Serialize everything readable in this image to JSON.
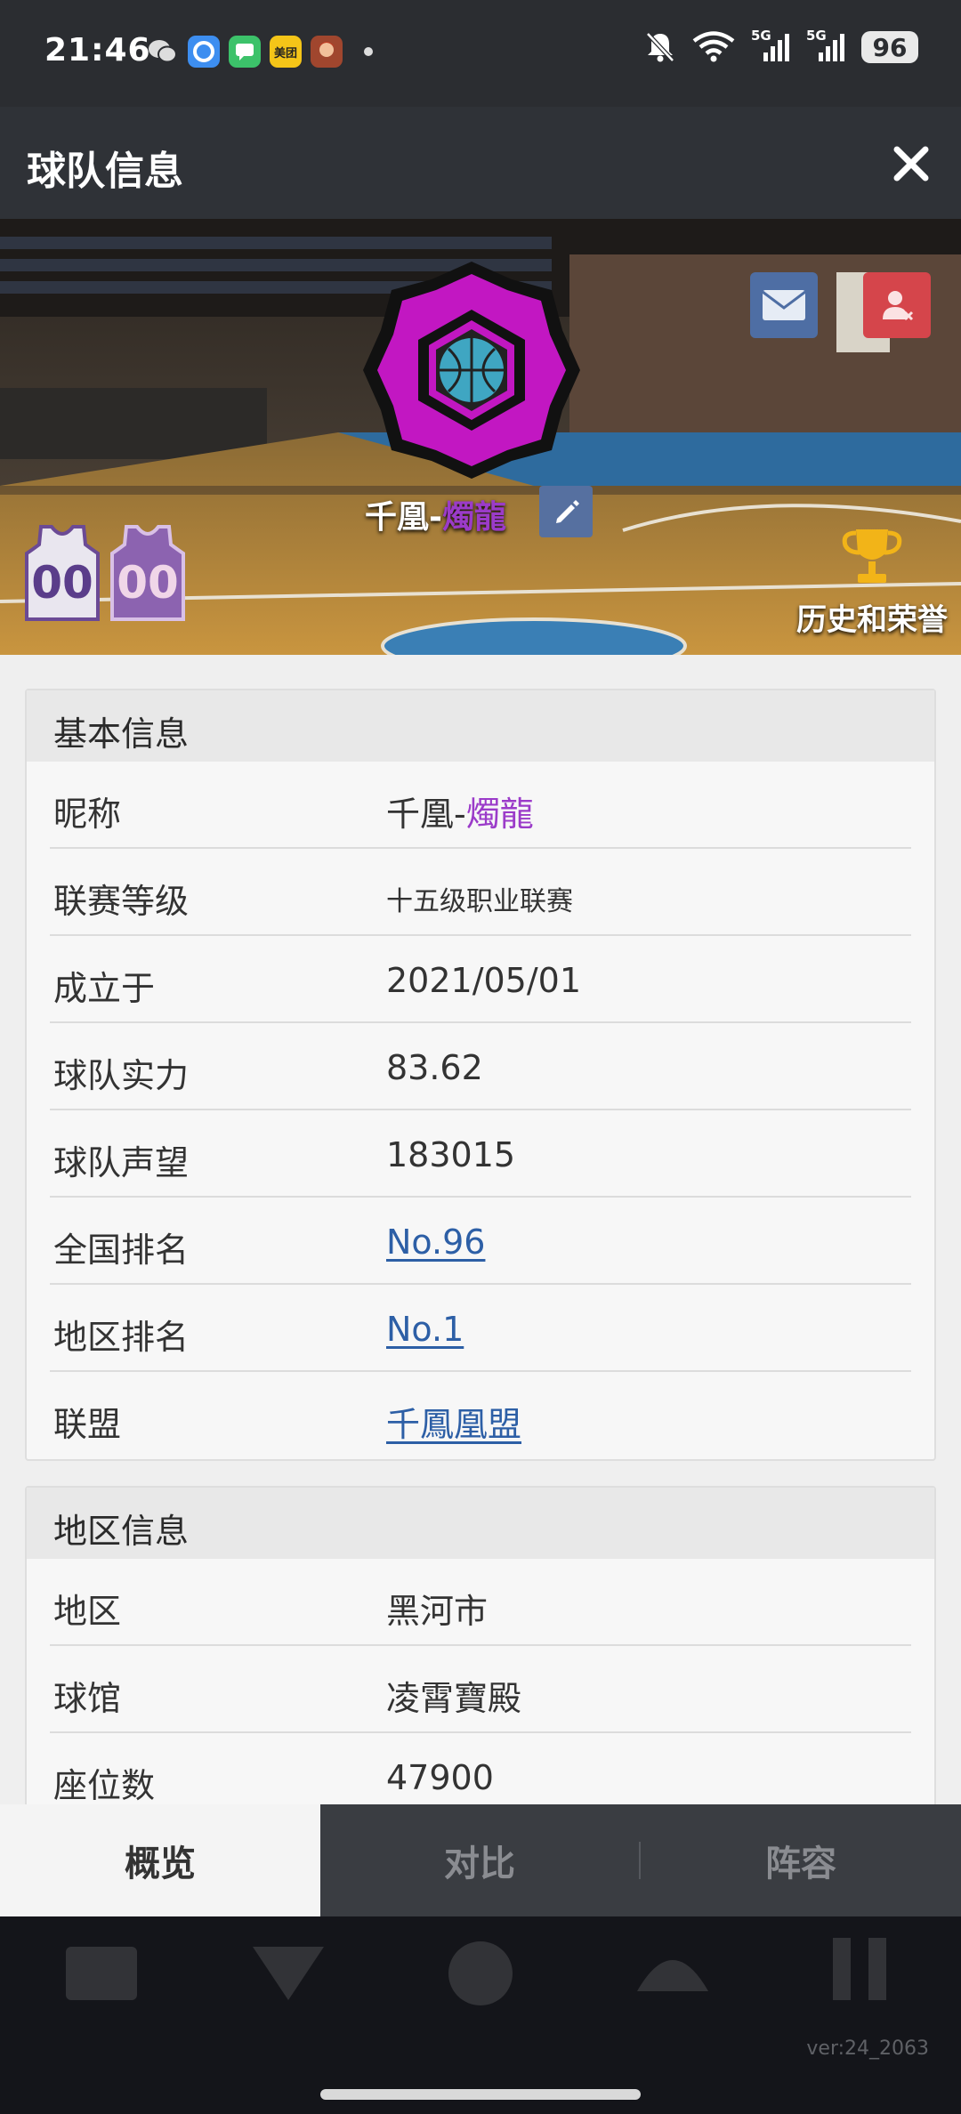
{
  "status_bar": {
    "time": "21:46",
    "apps": [
      {
        "name": "wechat-icon",
        "color": "#2b2d31",
        "label": ""
      },
      {
        "name": "browser-icon",
        "color": "#3d8ef0",
        "label": ""
      },
      {
        "name": "messages-icon",
        "color": "#3cc26a",
        "label": ""
      },
      {
        "name": "meituan-icon",
        "color": "#f5c518",
        "label": "美团"
      },
      {
        "name": "game-icon",
        "color": "#a0462e",
        "label": ""
      }
    ],
    "signal1_label": "5G",
    "signal2_label": "5G",
    "battery": "96"
  },
  "header": {
    "title": "球队信息"
  },
  "banner": {
    "team_name_prefix": "千凰-",
    "team_name_accent": "燭龍",
    "honors_label": "历史和荣誉",
    "jersey_number": "00"
  },
  "basic_info": {
    "title": "基本信息",
    "nickname": {
      "label": "昵称",
      "prefix": "千凰-",
      "accent": "燭龍"
    },
    "league": {
      "label": "联赛等级",
      "value": "十五级职业联赛"
    },
    "founded": {
      "label": "成立于",
      "value": "2021/05/01"
    },
    "strength": {
      "label": "球队实力",
      "value": "83.62"
    },
    "reputation": {
      "label": "球队声望",
      "value": "183015"
    },
    "national_rank": {
      "label": "全国排名",
      "value": "No.96"
    },
    "region_rank": {
      "label": "地区排名",
      "value": "No.1"
    },
    "alliance": {
      "label": "联盟",
      "value": "千鳳凰盟"
    }
  },
  "region_info": {
    "title": "地区信息",
    "region": {
      "label": "地区",
      "value": "黑河市"
    },
    "arena": {
      "label": "球馆",
      "value": "凌霄寶殿"
    },
    "seats": {
      "label": "座位数",
      "value": "47900"
    }
  },
  "tabs": {
    "overview": "概览",
    "compare": "对比",
    "lineup": "阵容"
  },
  "footer": {
    "version": "ver:24_2063"
  },
  "colors": {
    "accent_purple": "#9b3bc9",
    "link_blue": "#2d5fa6",
    "badge_magenta": "#c217c2"
  }
}
